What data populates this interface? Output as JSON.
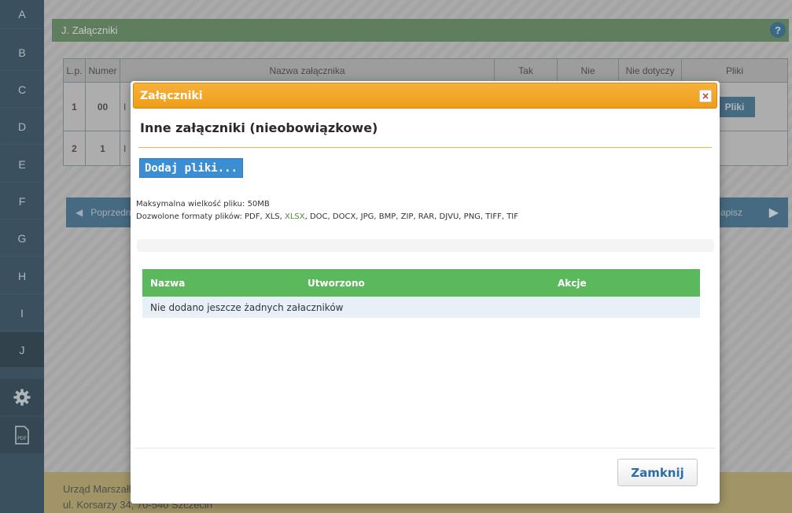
{
  "sidebar": {
    "letters": [
      "A",
      "B",
      "C",
      "D",
      "E",
      "F",
      "G",
      "H",
      "I",
      "J"
    ],
    "active": "J",
    "settings_icon": "gear-icon",
    "pdf_icon": "pdf-icon",
    "pdf_label": "PDF"
  },
  "section": {
    "title": "J.  Załączniki",
    "help_label": "?"
  },
  "bg_table": {
    "headers": [
      "L.p.",
      "Numer",
      "Nazwa załącznika",
      "Tak",
      "Nie",
      "Nie dotyczy",
      "Pliki"
    ],
    "rows": [
      {
        "lp": "1",
        "numer": "00",
        "name_fragment": "I",
        "pliki_button": "Pliki"
      },
      {
        "lp": "2",
        "numer": "1",
        "name_fragment": "I",
        "pliki_button": ""
      }
    ]
  },
  "nav": {
    "prev_label": "Poprzedn",
    "next_label": "apisz"
  },
  "footer": {
    "line1": "Urząd Marszałko",
    "line2": "ul. Korsarzy 34, 70-540 Szczecin"
  },
  "modal": {
    "title": "Załączniki",
    "close_icon_label": "×",
    "heading": "Inne załączniki (nieobowiązkowe)",
    "add_button": "Dodaj pliki...",
    "max_size": "Maksymalna wielkość pliku: 50MB",
    "allowed_formats_prefix": "Dozwolone formaty plików: PDF, XLS, ",
    "allowed_formats_highlight": "XLSX",
    "allowed_formats_suffix": ", DOC, DOCX, JPG, BMP, ZIP, RAR, DJVU, PNG, TIFF, TIF",
    "table": {
      "col_name": "Nazwa",
      "col_created": "Utworzono",
      "col_actions": "Akcje",
      "empty_message": "Nie dodano jeszcze żadnych załaczników"
    },
    "close_button": "Zamknij"
  },
  "colors": {
    "modal_title_bg": "#ef9d18",
    "add_button_bg": "#3b8ed2",
    "table_header_bg": "#5cb85c",
    "close_text": "#2c6ea5"
  }
}
